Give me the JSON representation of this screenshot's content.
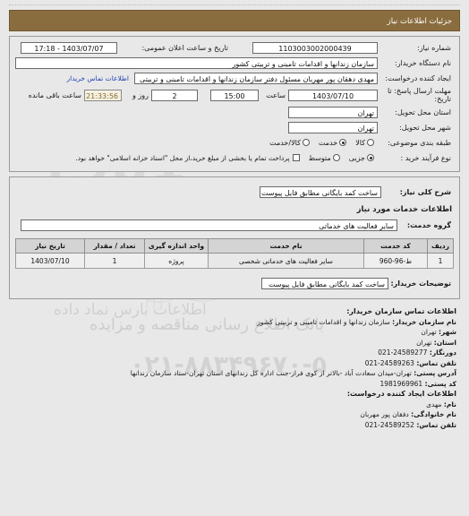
{
  "window": {
    "title": "جزئیات اطلاعات نیاز"
  },
  "need_info": {
    "need_number_label": "شماره نیاز:",
    "need_number_value": "1103003002000439",
    "announce_datetime_label": "تاریخ و ساعت اعلان عمومی:",
    "announce_datetime_value": "1403/07/07 - 17:18",
    "buyer_org_label": "نام دستگاه خریدار:",
    "buyer_org_value": "سازمان زندانها و اقدامات تامینی و تربیتی کشور",
    "creator_label": "ایجاد کننده درخواست:",
    "creator_value": "مهدی  دهقان پور مهربان مسئول دفتر سازمان زندانها و اقدامات تامینی و تربیتی",
    "buyer_contact_link": "اطلاعات تماس خریدار",
    "deadline_label": "مهلت ارسال پاسخ: تا تاریخ:",
    "deadline_date": "1403/07/10",
    "deadline_hour_label": "ساعت",
    "deadline_hour": "15:00",
    "remaining_days": "2",
    "remaining_days_label": "روز و",
    "remaining_time": "21:33:56",
    "remaining_time_label": "ساعت باقی مانده",
    "province_label": "استان محل تحویل:",
    "province_value": "تهران",
    "city_label": "شهر محل تحویل:",
    "city_value": "تهران",
    "category_label": "طبقه بندی موضوعی:",
    "category_options": [
      {
        "label": "کالا",
        "selected": false
      },
      {
        "label": "خدمت",
        "selected": true
      },
      {
        "label": "کالا/خدمت",
        "selected": false
      }
    ],
    "process_label": "نوع فرآیند خرید :",
    "process_options": [
      {
        "label": "جزیی",
        "selected": true
      },
      {
        "label": "متوسط",
        "selected": false
      }
    ],
    "treasury_checkbox_label": "پرداخت تمام یا بخشی از مبلغ خرید،از محل \"اسناد خزانه اسلامی\" خواهد بود.",
    "treasury_checked": false
  },
  "need_detail": {
    "summary_label": "شرح کلی نیاز:",
    "summary_value": "ساخت کمد بایگانی مطابق فایل پیوست",
    "services_section_title": "اطلاعات خدمات مورد نیاز",
    "service_group_label": "گروه خدمت:",
    "service_group_value": "سایر فعالیت های خدماتی",
    "table": {
      "headers": [
        "ردیف",
        "کد خدمت",
        "نام خدمت",
        "واحد اندازه گیری",
        "تعداد / مقدار",
        "تاریخ نیاز"
      ],
      "rows": [
        {
          "index": "1",
          "service_code": "ط-96-960",
          "service_name": "سایر فعالیت های خدماتی شخصی",
          "unit": "پروژه",
          "quantity": "1",
          "need_date": "1403/07/10"
        }
      ]
    },
    "buyer_notes_label": "توضیحات خریدار:",
    "buyer_notes_value": "ساخت کمد بایگانی مطابق فایل پیوست"
  },
  "contact": {
    "buyer_section_title": "اطلاعات تماس سازمان خریدار:",
    "buyer_org_name_label": "نام سازمان خریدار:",
    "buyer_org_name_value": "سازمان زندانها و اقدامات تامینی و تربیتی کشور",
    "city_label": "شهر:",
    "city_value": "تهران",
    "province_label": "استان:",
    "province_value": "تهران",
    "fax_label": "دورنگار:",
    "fax_value": "24589277-021",
    "phone_label": "تلفن تماس:",
    "phone_value": "24589263-021",
    "address_label": "آدرس پستی:",
    "address_value": "تهران-میدان سعادت آباد -بالاتر از کوی فراز-جنب اداره کل زندانهای استان تهران-ستاد سازمان زندانها",
    "postal_code_label": "کد پستی:",
    "postal_code_value": "1981969961",
    "creator_section_title": "اطلاعات ایجاد کننده درخواست:",
    "first_name_label": "نام:",
    "first_name_value": "مهدی",
    "last_name_label": "نام خانوادگی:",
    "last_name_value": "دفقان پور مهربان",
    "creator_phone_label": "تلفن تماس:",
    "creator_phone_value": "24589252-021"
  },
  "watermarks": {
    "code": "1981",
    "brand": "ParsNamadData",
    "persian_brand_1": "اطلاعات بارس نماد داده",
    "persian_brand_2": "بانک اطلاع رسانی مناقصه و مزایده",
    "phone": "۰۲۱-۸۸۳۴۹۶۷۰-۵"
  },
  "colors": {
    "header_bar": "#8a6d3f",
    "page_bg": "#e8e8e8",
    "link": "#1c3fb5",
    "timer_text": "#8a6a2f",
    "timer_bg": "#f4f1e1"
  }
}
